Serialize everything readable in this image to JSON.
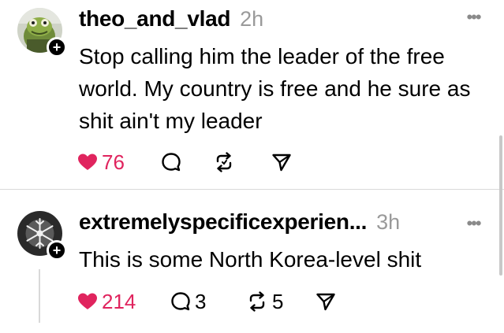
{
  "posts": [
    {
      "username": "theo_and_vlad",
      "time": "2h",
      "text": "Stop calling him the leader of the free world. My country is free and he sure as shit ain't my leader",
      "likes": "76",
      "replies": "",
      "reposts": "",
      "avatar_icon": "frog-avatar",
      "badge_icon": "plus-icon"
    },
    {
      "username": "extremelyspecificexperien...",
      "time": "3h",
      "text": "This is some North Korea-level shit",
      "likes": "214",
      "replies": "3",
      "reposts": "5",
      "avatar_icon": "snowflake-avatar",
      "badge_icon": "plus-icon"
    }
  ],
  "glyphs": {
    "more": "•••",
    "plus": "+"
  },
  "colors": {
    "like": "#e0245e",
    "muted": "#9a9a9a",
    "text": "#000000",
    "divider": "#d9d9d9"
  }
}
